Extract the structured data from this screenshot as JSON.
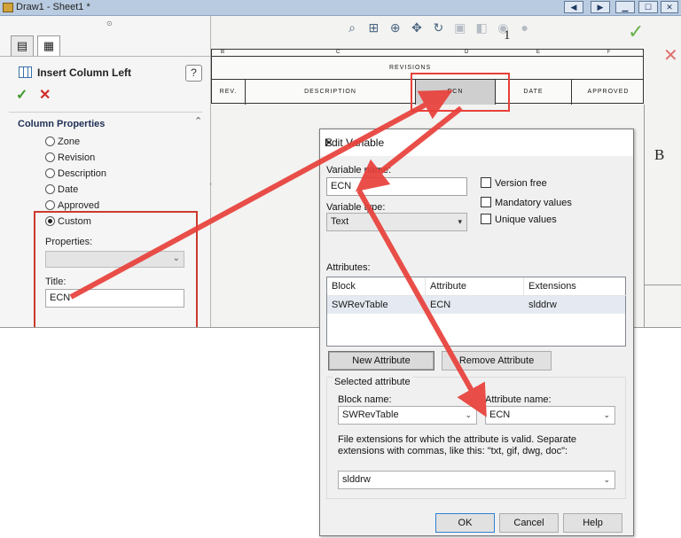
{
  "window": {
    "title": "Draw1 - Sheet1 *"
  },
  "property_manager": {
    "title": "Insert Column Left",
    "help_glyph": "?",
    "ok_glyph": "✓",
    "cancel_glyph": "✕",
    "group_title": "Column Properties",
    "options": [
      {
        "label": "Zone",
        "selected": false
      },
      {
        "label": "Revision",
        "selected": false
      },
      {
        "label": "Description",
        "selected": false
      },
      {
        "label": "Date",
        "selected": false
      },
      {
        "label": "Approved",
        "selected": false
      },
      {
        "label": "Custom",
        "selected": true
      }
    ],
    "properties_label": "Properties:",
    "properties_value": "",
    "title_label": "Title:",
    "title_value": "ECN"
  },
  "drawing": {
    "zone_letters": [
      "B",
      "C",
      "D",
      "E",
      "F"
    ],
    "table_title": "REVISIONS",
    "columns": [
      "REV.",
      "DESCRIPTION",
      "ECN",
      "DATE",
      "APPROVED"
    ],
    "selected_column": "ECN",
    "border_letter": "B",
    "sheet_marker": "1"
  },
  "dialog": {
    "title": "Edit Variable",
    "close_glyph": "✕",
    "variable_name_label": "Variable name:",
    "variable_name_value": "ECN",
    "variable_type_label": "Variable type:",
    "variable_type_value": "Text",
    "checkboxes": [
      "Version free",
      "Mandatory values",
      "Unique values"
    ],
    "attributes_label": "Attributes:",
    "attributes_table": {
      "headers": [
        "Block",
        "Attribute",
        "Extensions"
      ],
      "rows": [
        [
          "SWRevTable",
          "ECN",
          "slddrw"
        ]
      ]
    },
    "new_attribute_button": "New Attribute",
    "remove_attribute_button": "Remove Attribute",
    "selected_attribute_label": "Selected attribute",
    "block_name_label": "Block name:",
    "block_name_value": "SWRevTable",
    "attribute_name_label": "Attribute name:",
    "attribute_name_value": "ECN",
    "extensions_help": "File extensions for which the attribute is valid. Separate extensions with commas, like this: \"txt, gif, dwg, doc\":",
    "extensions_value": "slddrw",
    "ok_button": "OK",
    "cancel_button": "Cancel",
    "help_button": "Help"
  },
  "colors": {
    "annotation_red": "#e8403a",
    "accent_green": "#3f9b2e"
  }
}
